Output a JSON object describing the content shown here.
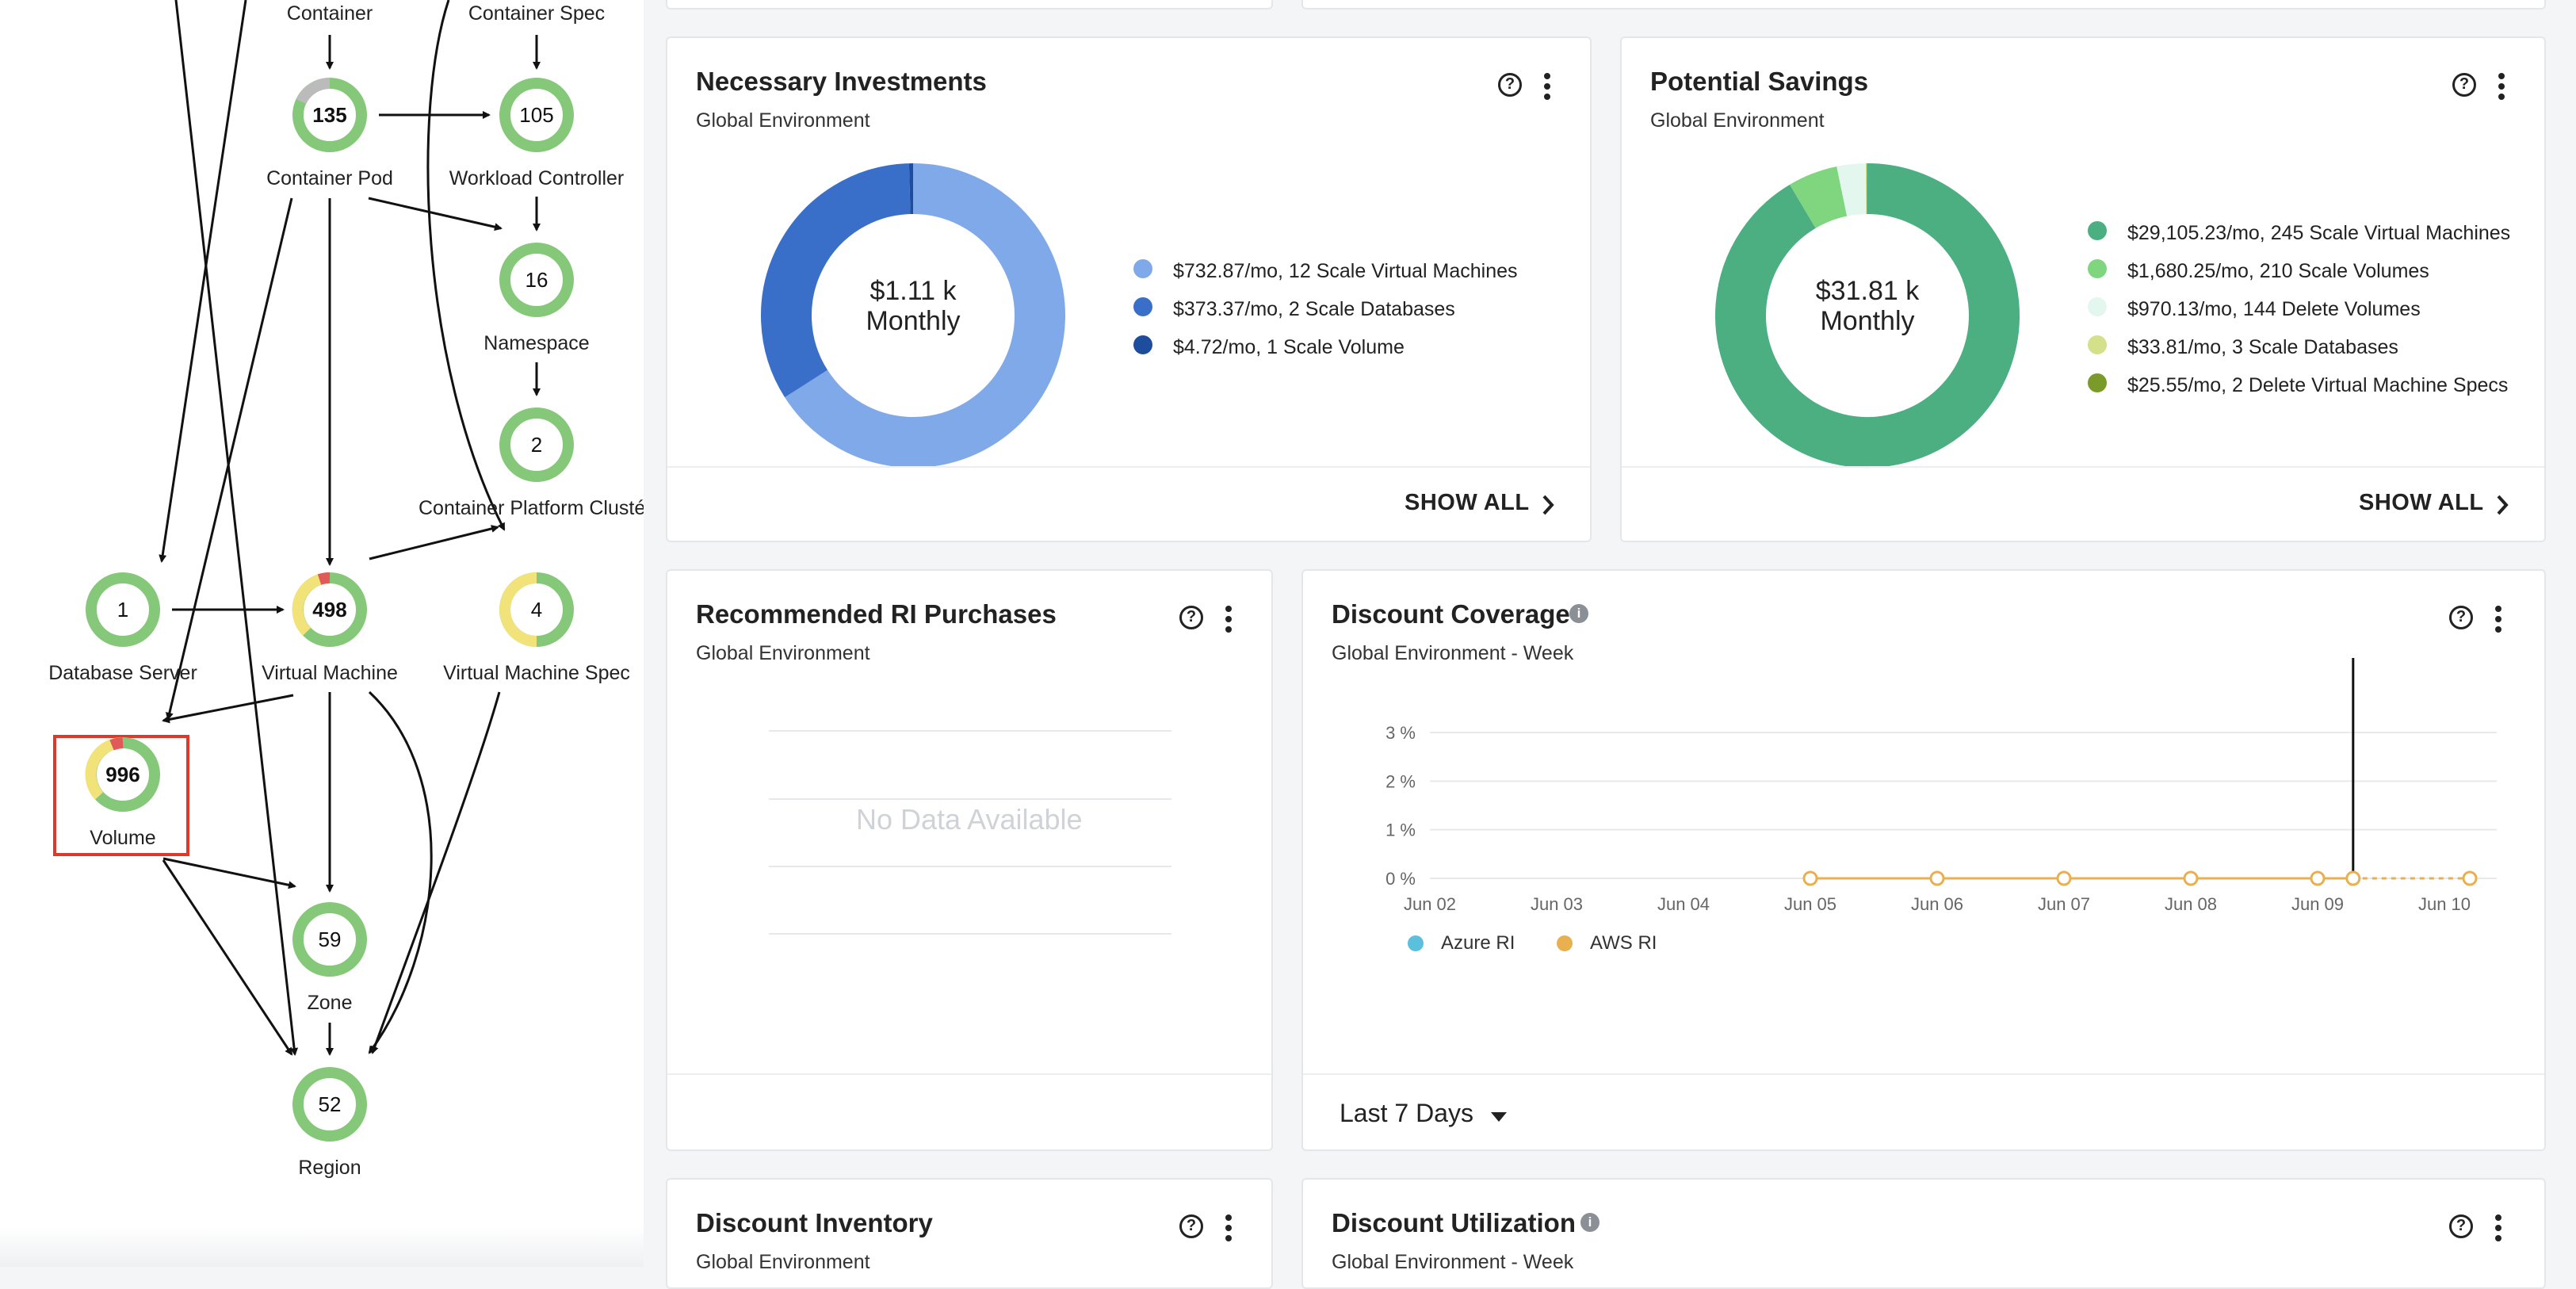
{
  "topology": {
    "nodes": [
      {
        "id": "container",
        "label": "Container",
        "count": ""
      },
      {
        "id": "container-spec",
        "label": "Container Spec",
        "count": ""
      },
      {
        "id": "container-pod",
        "label": "Container Pod",
        "count": "135"
      },
      {
        "id": "workload-controller",
        "label": "Workload Controller",
        "count": "105"
      },
      {
        "id": "namespace",
        "label": "Namespace",
        "count": "16"
      },
      {
        "id": "container-platform-cluster",
        "label": "Container Platform Clusté",
        "count": "2"
      },
      {
        "id": "database-server",
        "label": "Database Server",
        "count": "1"
      },
      {
        "id": "virtual-machine",
        "label": "Virtual Machine",
        "count": "498"
      },
      {
        "id": "virtual-machine-spec",
        "label": "Virtual Machine Spec",
        "count": "4"
      },
      {
        "id": "volume",
        "label": "Volume",
        "count": "996"
      },
      {
        "id": "zone",
        "label": "Zone",
        "count": "59"
      },
      {
        "id": "region",
        "label": "Region",
        "count": "52"
      }
    ],
    "selected": "Volume"
  },
  "necessary_investments": {
    "title": "Necessary Investments",
    "subtitle": "Global Environment",
    "center_value": "$1.11 k",
    "center_unit": "Monthly",
    "legend": [
      {
        "label": "$732.87/mo, 12 Scale Virtual Machines",
        "color": "#7fa9e8"
      },
      {
        "label": "$373.37/mo, 2 Scale Databases",
        "color": "#3a6fc9"
      },
      {
        "label": "$4.72/mo, 1 Scale Volume",
        "color": "#1f4d9e"
      }
    ],
    "show_all": "SHOW ALL"
  },
  "potential_savings": {
    "title": "Potential Savings",
    "subtitle": "Global Environment",
    "center_value": "$31.81 k",
    "center_unit": "Monthly",
    "legend": [
      {
        "label": "$29,105.23/mo, 245 Scale Virtual Machines",
        "color": "#4caf82"
      },
      {
        "label": "$1,680.25/mo, 210 Scale Volumes",
        "color": "#7fd67f"
      },
      {
        "label": "$970.13/mo, 144 Delete Volumes",
        "color": "#e4f7ef"
      },
      {
        "label": "$33.81/mo, 3 Scale Databases",
        "color": "#d4e08a"
      },
      {
        "label": "$25.55/mo, 2 Delete Virtual Machine Specs",
        "color": "#7a9a2a"
      }
    ],
    "show_all": "SHOW ALL"
  },
  "ri_purchases": {
    "title": "Recommended RI Purchases",
    "subtitle": "Global Environment",
    "empty_text": "No Data Available"
  },
  "discount_coverage": {
    "title": "Discount Coverage",
    "subtitle": "Global Environment - Week",
    "time_range": "Last 7 Days"
  },
  "discount_inventory": {
    "title": "Discount Inventory",
    "subtitle": "Global Environment"
  },
  "discount_utilization": {
    "title": "Discount Utilization",
    "subtitle": "Global Environment - Week"
  },
  "chart_data": [
    {
      "type": "pie",
      "title": "Necessary Investments",
      "categories": [
        "$732.87/mo, 12 Scale Virtual Machines",
        "$373.37/mo, 2 Scale Databases",
        "$4.72/mo, 1 Scale Volume"
      ],
      "values": [
        732.87,
        373.37,
        4.72
      ],
      "colors": [
        "#7fa9e8",
        "#3a6fc9",
        "#1f4d9e"
      ]
    },
    {
      "type": "pie",
      "title": "Potential Savings",
      "categories": [
        "$29,105.23/mo, 245 Scale Virtual Machines",
        "$1,680.25/mo, 210 Scale Volumes",
        "$970.13/mo, 144 Delete Volumes",
        "$33.81/mo, 3 Scale Databases",
        "$25.55/mo, 2 Delete Virtual Machine Specs"
      ],
      "values": [
        29105.23,
        1680.25,
        970.13,
        33.81,
        25.55
      ],
      "colors": [
        "#4caf82",
        "#7fd67f",
        "#e4f7ef",
        "#d4e08a",
        "#7a9a2a"
      ]
    },
    {
      "type": "line",
      "title": "Discount Coverage",
      "x_tick_labels": [
        "Jun 02",
        "Jun 03",
        "Jun 04",
        "Jun 05",
        "Jun 06",
        "Jun 07",
        "Jun 08",
        "Jun 09",
        "Jun 10"
      ],
      "y_tick_labels": [
        "0 %",
        "1 %",
        "2 %",
        "3 %"
      ],
      "ylim": [
        0,
        3
      ],
      "grid": true,
      "legend_position": "bottom-left",
      "series": [
        {
          "name": "Azure RI",
          "color": "#5bc0de",
          "points": []
        },
        {
          "name": "AWS RI",
          "color": "#e8b04f",
          "x": [
            "Jun 05",
            "Jun 06",
            "Jun 07",
            "Jun 08",
            "Jun 09",
            "Jun 09.6",
            "Jun 10"
          ],
          "values": [
            0,
            0,
            0,
            0,
            0,
            0,
            0
          ]
        }
      ]
    }
  ]
}
